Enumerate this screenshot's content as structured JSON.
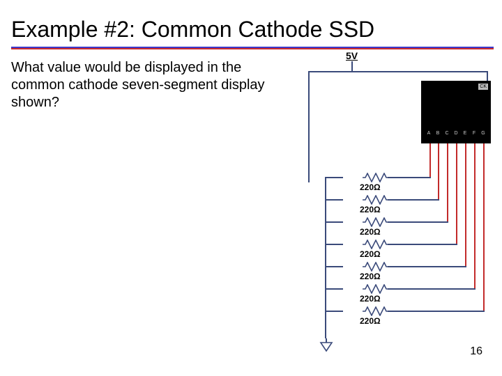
{
  "title": "Example #2: Common Cathode SSD",
  "body_text": "What value would be displayed in the common cathode seven-segment display shown?",
  "page_number": "16",
  "circuit": {
    "supply_label": "5V",
    "ssd_ck_label": "CK",
    "pins": [
      "A",
      "B",
      "C",
      "D",
      "E",
      "F",
      "G"
    ],
    "resistors": [
      {
        "value": "220Ω"
      },
      {
        "value": "220Ω"
      },
      {
        "value": "220Ω"
      },
      {
        "value": "220Ω"
      },
      {
        "value": "220Ω"
      },
      {
        "value": "220Ω"
      },
      {
        "value": "220Ω"
      }
    ]
  },
  "chart_data": {
    "type": "diagram",
    "description": "Common-cathode seven-segment display circuit. 5V supply connects to CK (common cathode) pin of SSD. Segment pins A–G each go through a 220Ω resistor to a common node, which is grounded.",
    "supply": "5V",
    "segments": [
      "A",
      "B",
      "C",
      "D",
      "E",
      "F",
      "G"
    ],
    "resistor_ohms": 220,
    "common_node": "ground"
  }
}
